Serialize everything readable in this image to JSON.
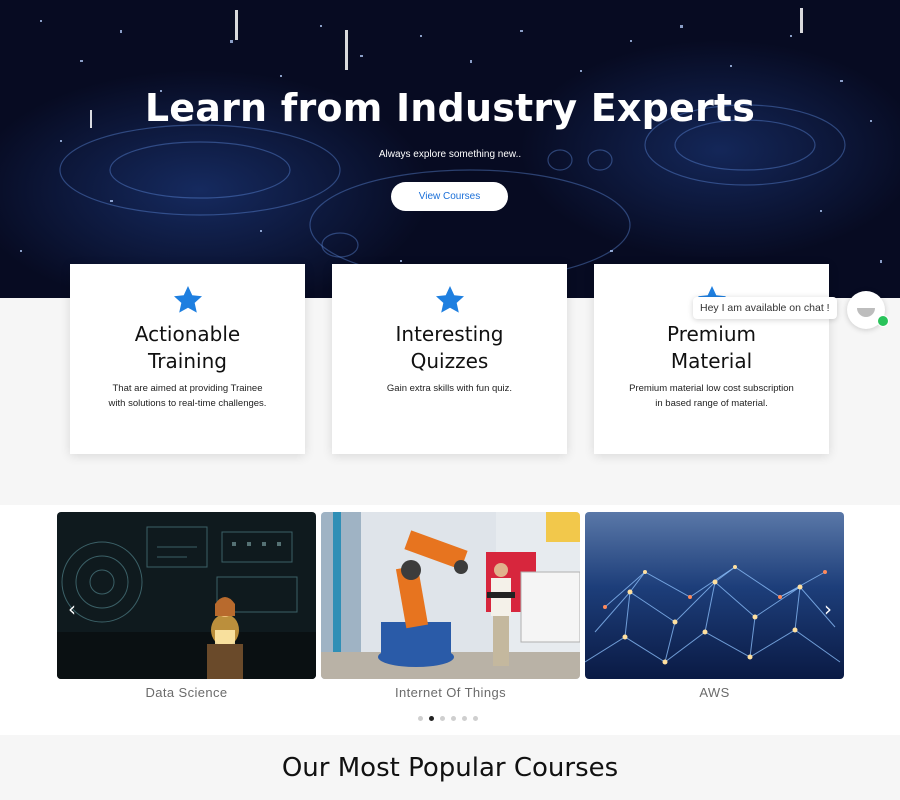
{
  "hero": {
    "title": "Learn from Industry Experts",
    "subtitle": "Always explore something new..",
    "cta_label": "View Courses"
  },
  "features": [
    {
      "icon": "star-icon",
      "title_line1": "Actionable",
      "title_line2": "Training",
      "text": "That are aimed at providing Trainee with solutions to real-time challenges."
    },
    {
      "icon": "star-icon",
      "title_line1": "Interesting",
      "title_line2": "Quizzes",
      "text": "Gain extra skills with fun quiz."
    },
    {
      "icon": "star-icon",
      "title_line1": "Premium",
      "title_line2": "Material",
      "text": "Premium material low cost subscription in based range of material."
    }
  ],
  "chat": {
    "message": "Hey I am available on chat !",
    "status": "online"
  },
  "carousel": {
    "slides": [
      {
        "label": "Data Science",
        "image": "data-science-image"
      },
      {
        "label": "Internet Of Things",
        "image": "iot-robot-image"
      },
      {
        "label": "AWS",
        "image": "aws-network-image"
      }
    ],
    "prev_icon": "chevron-left-icon",
    "next_icon": "chevron-right-icon",
    "dots_count": 6,
    "active_dot": 1
  },
  "popular": {
    "title": "Our Most Popular Courses"
  },
  "colors": {
    "accent": "#1a6fd8",
    "star": "#1e7fe0",
    "online": "#29c35a"
  }
}
